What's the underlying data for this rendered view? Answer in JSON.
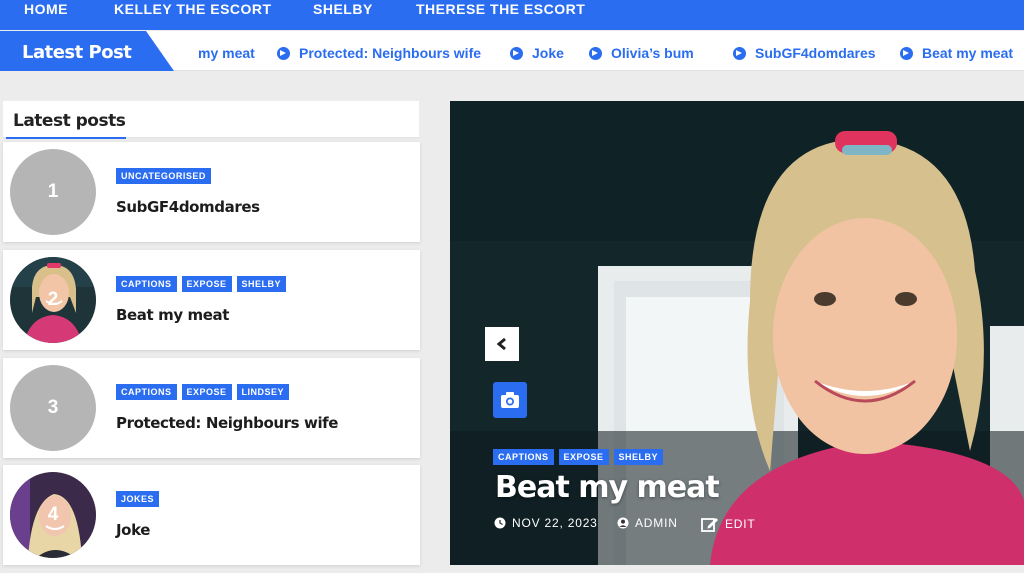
{
  "nav": {
    "items": [
      "HOME",
      "KELLEY THE ESCORT",
      "SHELBY",
      "THERESE THE ESCORT"
    ]
  },
  "ticker": {
    "label": "Latest Post",
    "items": [
      "my meat",
      "Protected: Neighbours wife",
      "Joke",
      "Olivia’s bum",
      "SubGF4domdares",
      "Beat my meat"
    ]
  },
  "sidebar": {
    "heading": "Latest posts",
    "posts": [
      {
        "num": "1",
        "tags": [
          "UNCATEGORISED"
        ],
        "title": "SubGF4domdares",
        "thumb": "grey-circle"
      },
      {
        "num": "2",
        "tags": [
          "CAPTIONS",
          "EXPOSE",
          "SHELBY"
        ],
        "title": "Beat my meat",
        "thumb": "photo-woman-blonde"
      },
      {
        "num": "3",
        "tags": [
          "CAPTIONS",
          "EXPOSE",
          "LINDSEY"
        ],
        "title": "Protected: Neighbours wife",
        "thumb": "grey-circle"
      },
      {
        "num": "4",
        "tags": [
          "JOKES"
        ],
        "title": "Joke",
        "thumb": "photo-woman-smiling"
      }
    ]
  },
  "hero": {
    "tags": [
      "CAPTIONS",
      "EXPOSE",
      "SHELBY"
    ],
    "title": "Beat my meat",
    "date": "NOV 22, 2023",
    "author": "ADMIN",
    "edit": "EDIT",
    "icons": [
      "chevron-left-icon",
      "camera-icon",
      "clock-icon",
      "user-icon",
      "edit-icon"
    ]
  },
  "colors": {
    "accent": "#2a6df0",
    "background": "#ececec"
  }
}
